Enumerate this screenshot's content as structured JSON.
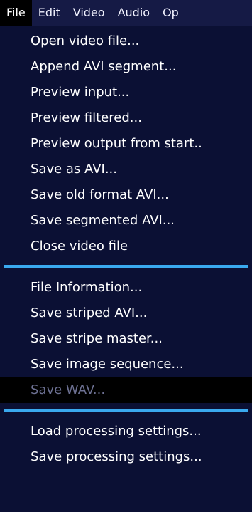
{
  "menubar": {
    "items": [
      {
        "label": "File"
      },
      {
        "label": "Edit"
      },
      {
        "label": "Video"
      },
      {
        "label": "Audio"
      },
      {
        "label": "Op"
      }
    ]
  },
  "file_menu": {
    "group1": [
      {
        "label": "Open video file..."
      },
      {
        "label": "Append AVI segment..."
      },
      {
        "label": "Preview input..."
      },
      {
        "label": "Preview filtered..."
      },
      {
        "label": "Preview output from start.."
      },
      {
        "label": "Save as AVI..."
      },
      {
        "label": "Save old format AVI..."
      },
      {
        "label": "Save segmented AVI..."
      },
      {
        "label": "Close video file"
      }
    ],
    "group2": [
      {
        "label": "File Information..."
      },
      {
        "label": "Save striped AVI..."
      },
      {
        "label": "Save stripe master..."
      },
      {
        "label": "Save image sequence..."
      },
      {
        "label": "Save WAV..."
      }
    ],
    "group3": [
      {
        "label": "Load processing settings..."
      },
      {
        "label": "Save processing settings..."
      }
    ]
  },
  "colors": {
    "menu_background": "#0b1034",
    "separator": "#3aa9ef",
    "highlight": "#000000",
    "disabled_text": "#6d7193"
  }
}
